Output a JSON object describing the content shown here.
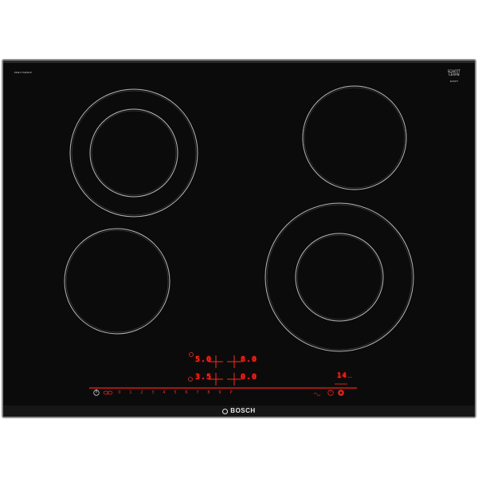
{
  "product": {
    "model_code": "PKN775DB1E",
    "badge_title": "SCHOTT",
    "badge_line2": "CERAN",
    "badge_sub": "SCHOTT",
    "brand": "BOSCH"
  },
  "displays": {
    "zone_front_left_level": "5.0",
    "zone_rear_left_level": "8.0",
    "zone_front_right_level": "3.5",
    "zone_rear_right_level": "0.0",
    "timer_readout": "14",
    "timer_unit": "—"
  },
  "control_bar": {
    "power_icon": "power-icon",
    "slider_levels": [
      "0",
      "1",
      "2",
      "3",
      "4",
      "5",
      "6",
      "7",
      "8",
      "9",
      "P"
    ],
    "timer_icon": "clock-icon",
    "lock_icon": "lock-icon",
    "accent_color": "#e8241a"
  },
  "colors": {
    "glass": "#0b0b0c",
    "frame": "#9a9a9a",
    "zone_ring": "#b9b9b9"
  }
}
